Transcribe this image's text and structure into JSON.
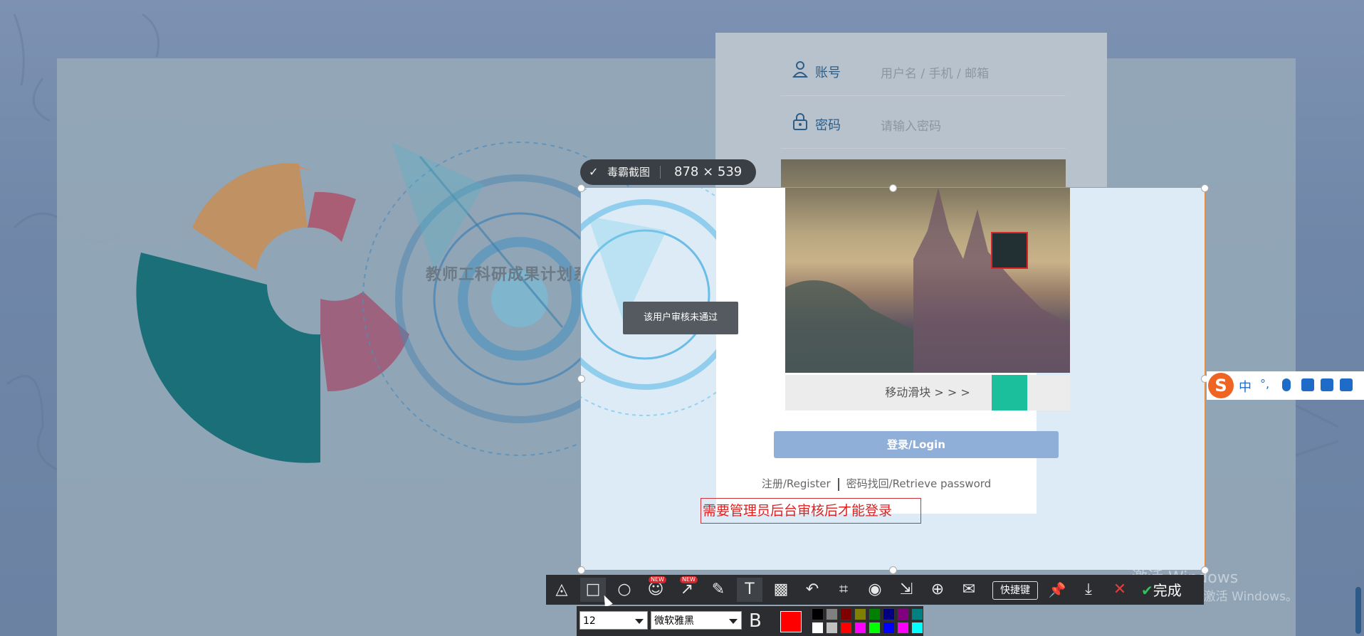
{
  "page": {
    "site_title": "教师工科研成果计划系统",
    "account_label": "账号",
    "account_placeholder": "用户名 / 手机 / 邮箱",
    "password_label": "密码",
    "password_placeholder": "请输入密码",
    "slider_text": "移动滑块 > > >",
    "login_button": "登录/Login",
    "register_link": "注册/Register",
    "retrieve_link": "密码找回/Retrieve password",
    "toast": "该用户审核未通过"
  },
  "annotation": {
    "text": "需要管理员后台审核后才能登录",
    "color": "#e02121"
  },
  "screenshot_tool": {
    "brand": "毒霸截图",
    "size": "878 × 539",
    "new_badge": "NEW",
    "hotkey_label": "快捷键",
    "done_label": "完成",
    "font_size": "12",
    "font_family": "微软雅黑",
    "bold_label": "B",
    "current_color": "#ff0000",
    "palette_top": [
      "#000000",
      "#808080",
      "#800000",
      "#808000",
      "#008000",
      "#000080",
      "#800080",
      "#008080"
    ],
    "palette_bottom": [
      "#ffffff",
      "#c0c0c0",
      "#ff0000",
      "#ff00ff",
      "#00ff00",
      "#0000ff",
      "#ff00ff",
      "#00ffff"
    ],
    "tools": [
      {
        "name": "shape-tool-icon",
        "glyph": "◬"
      },
      {
        "name": "rectangle-icon",
        "glyph": "□"
      },
      {
        "name": "ellipse-icon",
        "glyph": "○"
      },
      {
        "name": "emoji-icon",
        "glyph": "☺"
      },
      {
        "name": "arrow-icon",
        "glyph": "↗"
      },
      {
        "name": "marker-icon",
        "glyph": "✎"
      },
      {
        "name": "text-icon",
        "glyph": "T"
      },
      {
        "name": "mosaic-icon",
        "glyph": "▩"
      },
      {
        "name": "undo-icon",
        "glyph": "↶"
      },
      {
        "name": "ocr-icon",
        "glyph": "⌗"
      },
      {
        "name": "record-icon",
        "glyph": "◉"
      },
      {
        "name": "long-screenshot-icon",
        "glyph": "⇲"
      },
      {
        "name": "add-capture-icon",
        "glyph": "⊕"
      },
      {
        "name": "comment-icon",
        "glyph": "✉"
      }
    ]
  },
  "ime": {
    "zh_label": "中",
    "punct_label": "°,"
  },
  "watermark": {
    "line1": "激活 Windows",
    "line2": "转到\"设置\"以激活 Windows。"
  }
}
